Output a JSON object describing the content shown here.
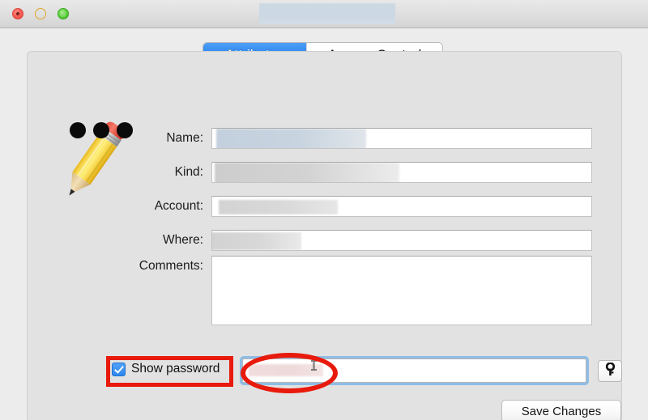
{
  "window": {
    "title": "",
    "title_redacted": true,
    "traffic_lights": [
      {
        "name": "close",
        "color": "#fb6159"
      },
      {
        "name": "minimize",
        "color": "#fdc441"
      },
      {
        "name": "zoom",
        "color": "#5fcf3e"
      }
    ]
  },
  "tabs": [
    {
      "label": "Attributes",
      "selected": true
    },
    {
      "label": "Access Control",
      "selected": false
    }
  ],
  "icon": {
    "name": "pencil-icon",
    "dots_count": 3
  },
  "form": {
    "fields": [
      {
        "label": "Name:",
        "value": "",
        "redacted": true,
        "type": "text"
      },
      {
        "label": "Kind:",
        "value": "",
        "redacted": true,
        "type": "text"
      },
      {
        "label": "Account:",
        "value": "",
        "redacted": true,
        "type": "text"
      },
      {
        "label": "Where:",
        "value": "",
        "redacted": true,
        "type": "text"
      },
      {
        "label": "Comments:",
        "value": "",
        "redacted": false,
        "type": "textarea"
      }
    ]
  },
  "password_row": {
    "checkbox_label": "Show password",
    "checkbox_checked": true,
    "password_value": "",
    "password_redacted": true,
    "key_button_icon": "key-icon"
  },
  "buttons": {
    "save_label": "Save Changes"
  },
  "annotations": [
    {
      "shape": "rectangle",
      "color": "#e81a0c",
      "targets": "show-password-checkbox"
    },
    {
      "shape": "ellipse",
      "color": "#e81a0c",
      "targets": "password-field-value"
    }
  ],
  "colors": {
    "accent_blue": "#2c85ef",
    "annotation_red": "#e81a0c",
    "panel_bg": "#e2e2e2",
    "window_bg": "#ececec"
  }
}
